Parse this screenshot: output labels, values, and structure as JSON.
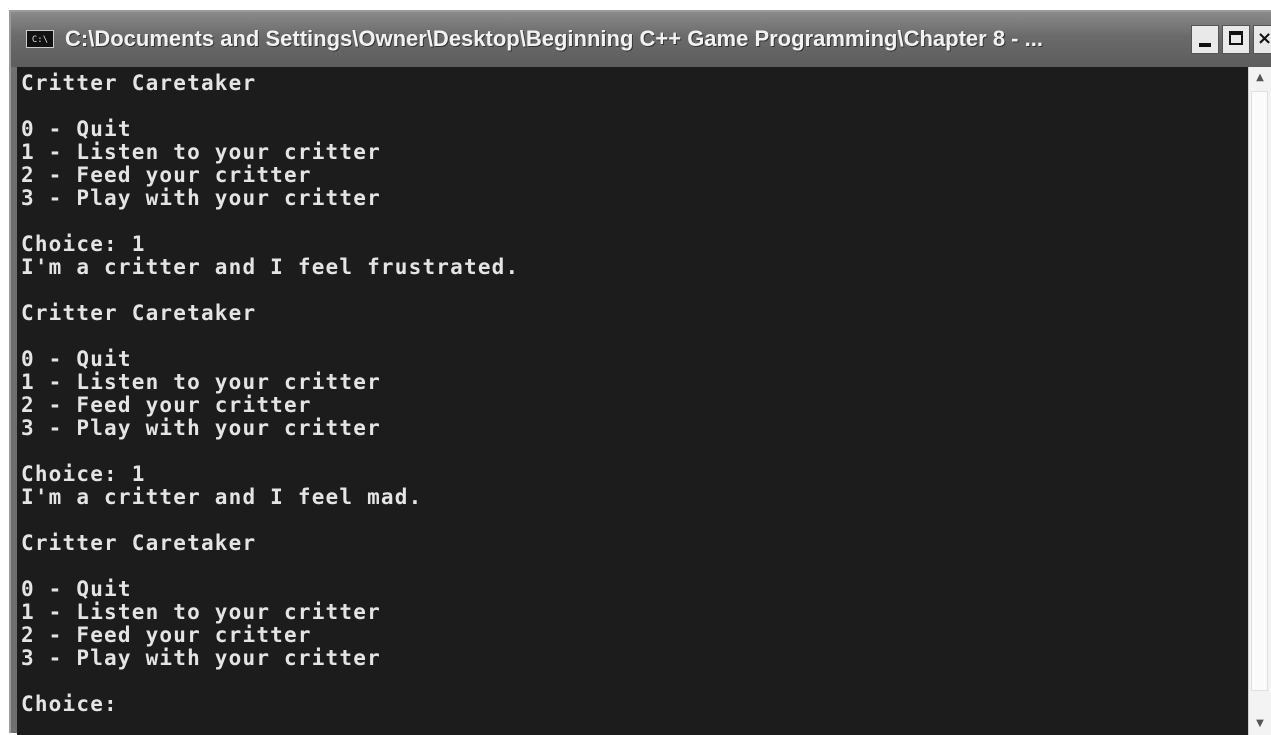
{
  "window": {
    "title": "C:\\Documents and Settings\\Owner\\Desktop\\Beginning C++ Game Programming\\Chapter 8 - ...",
    "icon": "console-app-icon",
    "icon_text": "C:\\",
    "controls": {
      "minimize_icon": "minimize-icon",
      "maximize_icon": "maximize-icon",
      "close_label": "×"
    }
  },
  "console": {
    "lines": [
      "Critter Caretaker",
      "",
      "0 - Quit",
      "1 - Listen to your critter",
      "2 - Feed your critter",
      "3 - Play with your critter",
      "",
      "Choice: 1",
      "I'm a critter and I feel frustrated.",
      "",
      "Critter Caretaker",
      "",
      "0 - Quit",
      "1 - Listen to your critter",
      "2 - Feed your critter",
      "3 - Play with your critter",
      "",
      "Choice: 1",
      "I'm a critter and I feel mad.",
      "",
      "Critter Caretaker",
      "",
      "0 - Quit",
      "1 - Listen to your critter",
      "2 - Feed your critter",
      "3 - Play with your critter",
      "",
      "Choice:"
    ]
  },
  "scrollbar": {
    "up_icon": "scroll-up-arrow-icon",
    "down_icon": "scroll-down-arrow-icon",
    "position": "bottom"
  },
  "colors": {
    "console_background": "#1c1c1c",
    "console_text": "#e4e4e4",
    "titlebar": "#6a6a6a"
  }
}
